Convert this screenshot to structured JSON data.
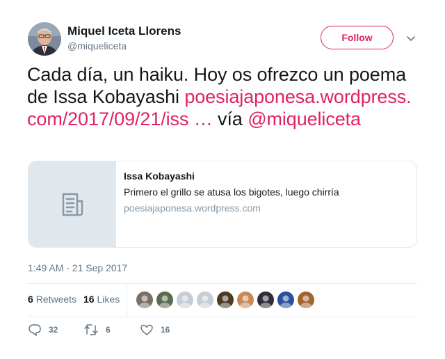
{
  "author": {
    "name": "Miquel Iceta Llorens",
    "handle": "@miqueliceta",
    "avatar_icon": "profile-photo"
  },
  "follow_button": {
    "label": "Follow"
  },
  "tweet": {
    "text_part1": "Cada día, un haiku. Hoy os ofrezco un poema de Issa Kobayashi ",
    "link_text": "poesiajaponesa.wordpress.com/2017/09/21/iss …",
    "via_text": " vía ",
    "mention": "@miqueliceta"
  },
  "card": {
    "thumbnail_icon": "document-icon",
    "title": "Issa Kobayashi",
    "description": "Primero el grillo se atusa los bigotes, luego chirría",
    "domain": "poesiajaponesa.wordpress.com"
  },
  "timestamp": "1:49 AM - 21 Sep 2017",
  "stats": {
    "retweets_count": "6",
    "retweets_label": "Retweets",
    "likes_count": "16",
    "likes_label": "Likes"
  },
  "likers": [
    {
      "name": "liker-avatar-1",
      "color": "#7a6f66"
    },
    {
      "name": "liker-avatar-2",
      "color": "#5b6b4e"
    },
    {
      "name": "liker-avatar-3",
      "color": "#c5ced6"
    },
    {
      "name": "liker-avatar-4",
      "color": "#c5ced6"
    },
    {
      "name": "liker-avatar-5",
      "color": "#4a3b22"
    },
    {
      "name": "liker-avatar-6",
      "color": "#c98a5b"
    },
    {
      "name": "liker-avatar-7",
      "color": "#2e2e3a"
    },
    {
      "name": "liker-avatar-8",
      "color": "#2a4f9e"
    },
    {
      "name": "liker-avatar-9",
      "color": "#a0652e"
    }
  ],
  "actions": {
    "reply_count": "32",
    "retweet_count": "6",
    "like_count": "16"
  },
  "colors": {
    "accent": "#e0245e",
    "text": "#14171a",
    "secondary": "#657786",
    "border": "#e1e8ed"
  }
}
